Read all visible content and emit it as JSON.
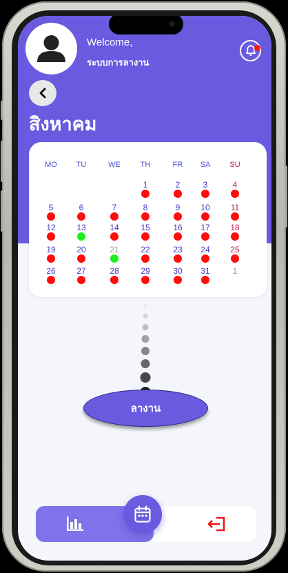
{
  "header": {
    "welcome": "Welcome,",
    "app_name": "ระบบการลางาน",
    "month": "สิงหาคม"
  },
  "calendar": {
    "weekdays": [
      "MO",
      "TU",
      "WE",
      "TH",
      "FR",
      "SA",
      "SU"
    ],
    "weeks": [
      [
        null,
        null,
        null,
        {
          "d": "1",
          "s": "red"
        },
        {
          "d": "2",
          "s": "red"
        },
        {
          "d": "3",
          "s": "red"
        },
        {
          "d": "4",
          "s": "red"
        }
      ],
      [
        {
          "d": "5",
          "s": "red"
        },
        {
          "d": "6",
          "s": "red"
        },
        {
          "d": "7",
          "s": "red"
        },
        {
          "d": "8",
          "s": "red"
        },
        {
          "d": "9",
          "s": "red"
        },
        {
          "d": "10",
          "s": "red"
        },
        {
          "d": "11",
          "s": "red"
        }
      ],
      [
        {
          "d": "12",
          "s": "red"
        },
        {
          "d": "13",
          "s": "green"
        },
        {
          "d": "14",
          "s": "red"
        },
        {
          "d": "15",
          "s": "red"
        },
        {
          "d": "16",
          "s": "red"
        },
        {
          "d": "17",
          "s": "red"
        },
        {
          "d": "18",
          "s": "red"
        }
      ],
      [
        {
          "d": "19",
          "s": "red"
        },
        {
          "d": "20",
          "s": "red"
        },
        {
          "d": "21",
          "s": "green",
          "grey": true
        },
        {
          "d": "22",
          "s": "red"
        },
        {
          "d": "23",
          "s": "red"
        },
        {
          "d": "24",
          "s": "red"
        },
        {
          "d": "25",
          "s": "red"
        }
      ],
      [
        {
          "d": "26",
          "s": "red"
        },
        {
          "d": "27",
          "s": "red"
        },
        {
          "d": "28",
          "s": "red"
        },
        {
          "d": "29",
          "s": "red"
        },
        {
          "d": "30",
          "s": "red"
        },
        {
          "d": "31",
          "s": "red"
        },
        {
          "d": "1",
          "s": null,
          "grey": true
        }
      ]
    ]
  },
  "leave_button": "ลางาน",
  "colors": {
    "primary": "#6a5ae0",
    "dot_red": "#ff0d0d",
    "dot_green": "#1df01d",
    "sunday": "#c0184a"
  },
  "icons": {
    "avatar": "user-icon",
    "bell": "bell-icon",
    "back": "chevron-left-icon",
    "chart": "bar-chart-icon",
    "calendar": "calendar-icon",
    "logout": "logout-icon"
  }
}
